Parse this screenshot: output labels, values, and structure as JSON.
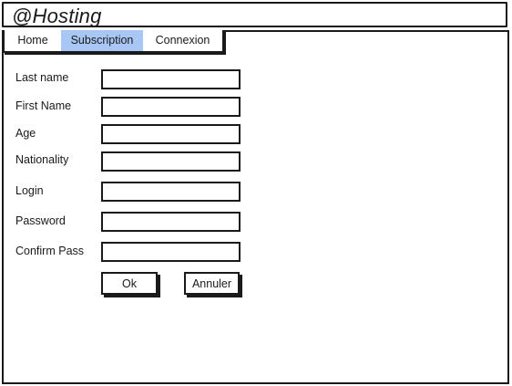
{
  "app": {
    "title": "@Hosting"
  },
  "tabs": [
    {
      "label": "Home",
      "active": false
    },
    {
      "label": "Subscription",
      "active": true
    },
    {
      "label": "Connexion",
      "active": false
    }
  ],
  "form": {
    "fields": [
      {
        "label": "Last name",
        "value": ""
      },
      {
        "label": "First Name",
        "value": ""
      },
      {
        "label": "Age",
        "value": ""
      },
      {
        "label": "Nationality",
        "value": ""
      },
      {
        "label": "Login",
        "value": ""
      },
      {
        "label": "Password",
        "value": ""
      },
      {
        "label": "Confirm Pass",
        "value": ""
      }
    ],
    "ok_label": "Ok",
    "cancel_label": "Annuler"
  },
  "colors": {
    "active_tab": "#a9c7f5",
    "stroke": "#1a1a1a"
  }
}
